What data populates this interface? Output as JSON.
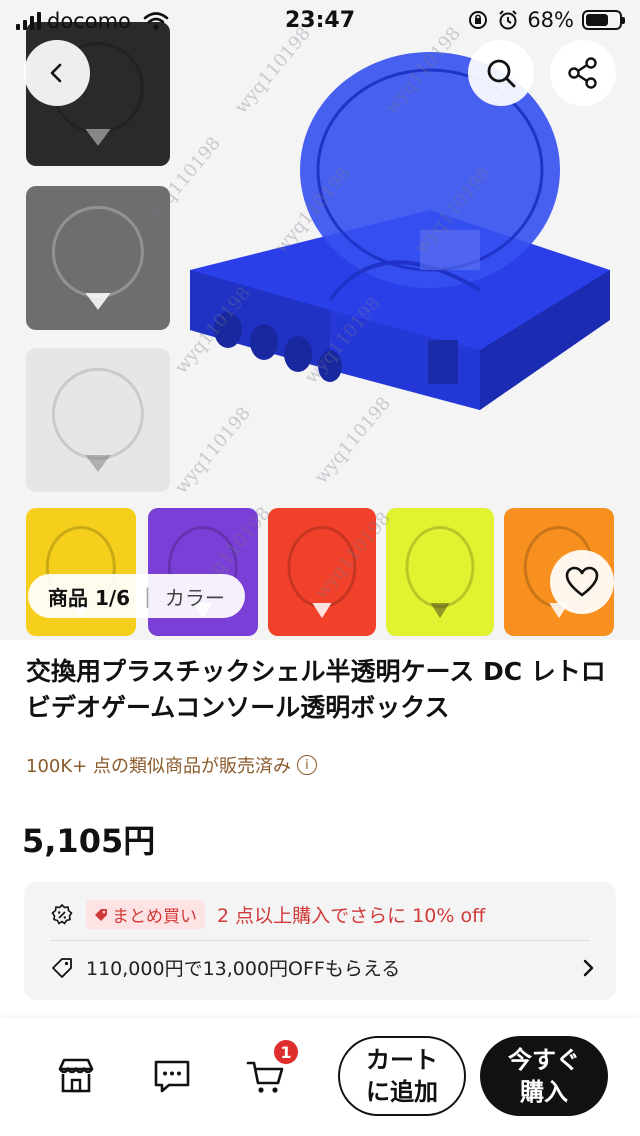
{
  "status_bar": {
    "carrier": "docomo",
    "time": "23:47",
    "battery": "68%"
  },
  "gallery": {
    "counter": "商品 1/6",
    "color_tab": "カラー",
    "watermark": "wyq110198",
    "colors": {
      "black": "#2a2a2a",
      "smoke": "#6e6e6e",
      "clear": "#e6e6e6",
      "blue": "#2a3fe8",
      "yellow": "#f6cf1c",
      "purple": "#7a3fd6",
      "red": "#f2412a",
      "lime": "#e3f230",
      "orange": "#f7901e"
    }
  },
  "product": {
    "title": "交換用プラスチックシェル半透明ケース DC レトロビデオゲームコンソール透明ボックス",
    "sold": "100K+ 点の類似商品が販売済み",
    "price": "5,105円"
  },
  "promo": {
    "badge": "まとめ買い",
    "bulk_text": "2 点以上購入でさらに 10% off",
    "coupon_text": "110,000円で13,000円OFFもらえる"
  },
  "bottom": {
    "cart_count": "1",
    "add_to_cart": "カート\nに追加",
    "buy_now": "今すぐ\n購入"
  }
}
